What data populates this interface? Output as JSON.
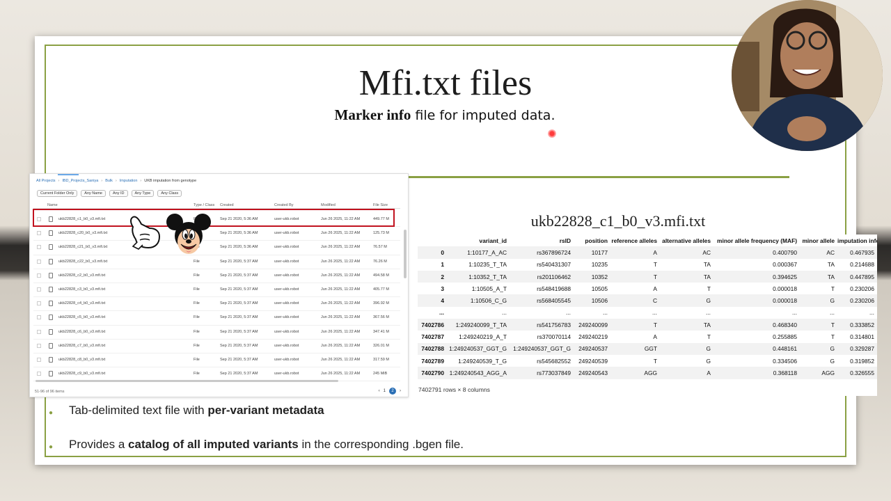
{
  "slide": {
    "title": "Mfi.txt files",
    "subtitle_bold": "Marker info",
    "subtitle_rest": " file for imputed data."
  },
  "browser": {
    "breadcrumbs": [
      "All Projects",
      "IBD_Projects_Saniya",
      "Bulk",
      "Imputation",
      "UKB imputation from genotype"
    ],
    "filters": [
      "Current Folder Only",
      "Any Name",
      "Any ID",
      "Any Type",
      "Any Class"
    ],
    "headers": {
      "name": "Name",
      "type": "Type / Class",
      "created": "Created",
      "created_by": "Created By",
      "modified": "Modified",
      "size": "File Size"
    },
    "rows": [
      {
        "name": "ukb22828_c1_b0_v3.mfi.txt",
        "type": "File",
        "created": "Sep 21 2020, 5:36 AM",
        "by": "user-ukb.robot",
        "modified": "Jun 26 2025, 11:22 AM",
        "size": "449.77 M"
      },
      {
        "name": "ukb22828_c20_b0_v3.mfi.txt",
        "type": "File",
        "created": "Sep 21 2020, 5:36 AM",
        "by": "user-ukb.robot",
        "modified": "Jun 26 2025, 11:22 AM",
        "size": "125.73 M"
      },
      {
        "name": "ukb22828_c21_b0_v3.mfi.txt",
        "type": "File",
        "created": "Sep 21 2020, 5:36 AM",
        "by": "user-ukb.robot",
        "modified": "Jun 26 2025, 11:22 AM",
        "size": "76.57 M"
      },
      {
        "name": "ukb22828_c22_b0_v3.mfi.txt",
        "type": "File",
        "created": "Sep 21 2020, 5:37 AM",
        "by": "user-ukb.robot",
        "modified": "Jun 26 2025, 11:22 AM",
        "size": "76.26 M"
      },
      {
        "name": "ukb22828_c2_b0_v3.mfi.txt",
        "type": "File",
        "created": "Sep 21 2020, 5:37 AM",
        "by": "user-ukb.robot",
        "modified": "Jun 26 2025, 11:22 AM",
        "size": "494.58 M"
      },
      {
        "name": "ukb22828_c3_b0_v3.mfi.txt",
        "type": "File",
        "created": "Sep 21 2020, 5:37 AM",
        "by": "user-ukb.robot",
        "modified": "Jun 26 2025, 11:22 AM",
        "size": "405.77 M"
      },
      {
        "name": "ukb22828_c4_b0_v3.mfi.txt",
        "type": "File",
        "created": "Sep 21 2020, 5:37 AM",
        "by": "user-ukb.robot",
        "modified": "Jun 26 2025, 11:22 AM",
        "size": "396.92 M"
      },
      {
        "name": "ukb22828_c5_b0_v3.mfi.txt",
        "type": "File",
        "created": "Sep 21 2020, 5:37 AM",
        "by": "user-ukb.robot",
        "modified": "Jun 26 2025, 11:22 AM",
        "size": "367.56 M"
      },
      {
        "name": "ukb22828_c6_b0_v3.mfi.txt",
        "type": "File",
        "created": "Sep 21 2020, 5:37 AM",
        "by": "user-ukb.robot",
        "modified": "Jun 26 2025, 11:22 AM",
        "size": "347.41 M"
      },
      {
        "name": "ukb22828_c7_b0_v3.mfi.txt",
        "type": "File",
        "created": "Sep 21 2020, 5:37 AM",
        "by": "user-ukb.robot",
        "modified": "Jun 26 2025, 11:22 AM",
        "size": "326.01 M"
      },
      {
        "name": "ukb22828_c8_b0_v3.mfi.txt",
        "type": "File",
        "created": "Sep 21 2020, 5:37 AM",
        "by": "user-ukb.robot",
        "modified": "Jun 26 2025, 11:22 AM",
        "size": "317.59 M"
      },
      {
        "name": "ukb22828_c9_b0_v3.mfi.txt",
        "type": "File",
        "created": "Sep 21 2020, 5:37 AM",
        "by": "user-ukb.robot",
        "modified": "Jun 26 2025, 11:22 AM",
        "size": "245 MiB"
      }
    ],
    "footer": "51-96 of 96 items",
    "pages": [
      "1",
      "2"
    ]
  },
  "dataframe": {
    "title": "ukb22828_c1_b0_v3.mfi.txt",
    "columns": [
      "",
      "variant_id",
      "rsID",
      "position",
      "reference alleles",
      "alternative alleles",
      "minor allele frequency (MAF)",
      "minor allele",
      "imputation info"
    ],
    "rows": [
      [
        "0",
        "1:10177_A_AC",
        "rs367896724",
        "10177",
        "A",
        "AC",
        "0.400790",
        "AC",
        "0.467935"
      ],
      [
        "1",
        "1:10235_T_TA",
        "rs540431307",
        "10235",
        "T",
        "TA",
        "0.000367",
        "TA",
        "0.214688"
      ],
      [
        "2",
        "1:10352_T_TA",
        "rs201106462",
        "10352",
        "T",
        "TA",
        "0.394625",
        "TA",
        "0.447895"
      ],
      [
        "3",
        "1:10505_A_T",
        "rs548419688",
        "10505",
        "A",
        "T",
        "0.000018",
        "T",
        "0.230206"
      ],
      [
        "4",
        "1:10506_C_G",
        "rs568405545",
        "10506",
        "C",
        "G",
        "0.000018",
        "G",
        "0.230206"
      ],
      [
        "...",
        "...",
        "...",
        "...",
        "...",
        "...",
        "...",
        "...",
        "..."
      ],
      [
        "7402786",
        "1:249240099_T_TA",
        "rs541756783",
        "249240099",
        "T",
        "TA",
        "0.468340",
        "T",
        "0.333852"
      ],
      [
        "7402787",
        "1:249240219_A_T",
        "rs370070114",
        "249240219",
        "A",
        "T",
        "0.255885",
        "T",
        "0.314801"
      ],
      [
        "7402788",
        "1:249240537_GGT_G",
        "1:249240537_GGT_G",
        "249240537",
        "GGT",
        "G",
        "0.448161",
        "G",
        "0.329287"
      ],
      [
        "7402789",
        "1:249240539_T_G",
        "rs545682552",
        "249240539",
        "T",
        "G",
        "0.334506",
        "G",
        "0.319852"
      ],
      [
        "7402790",
        "1:249240543_AGG_A",
        "rs773037849",
        "249240543",
        "AGG",
        "A",
        "0.368118",
        "AGG",
        "0.326555"
      ]
    ],
    "shape": "7402791 rows × 8 columns"
  },
  "bullets": [
    {
      "pre": "Tab-delimited text file with ",
      "bold": "per-variant metadata",
      "post": ""
    },
    {
      "pre": "Provides a ",
      "bold": "catalog of all imputed variants",
      "post": " in the corresponding .bgen file."
    }
  ],
  "colors": {
    "accent_green": "#8aa043",
    "highlight_red": "#c1121f",
    "link_blue": "#2a6fb5"
  }
}
